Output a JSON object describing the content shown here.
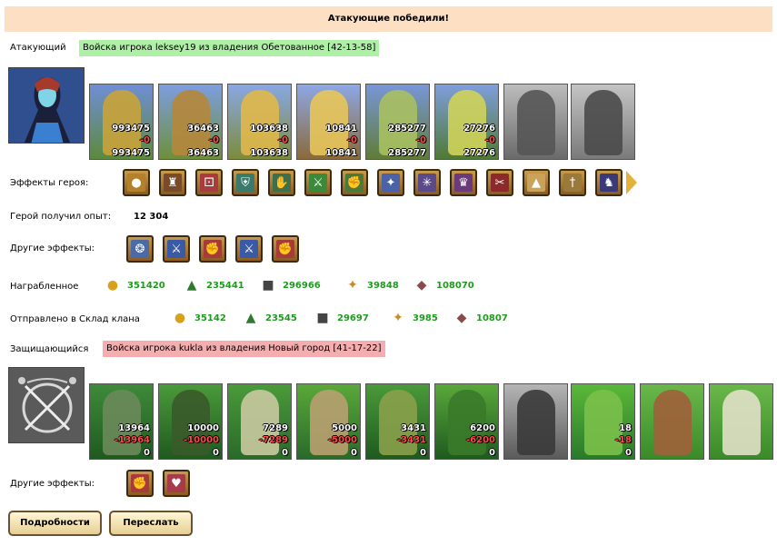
{
  "banner": "Атакующие победили!",
  "attacker": {
    "label": "Атакующий",
    "army": "Войска игрока leksey19 из владения Обетованное [42-13-58]",
    "units": [
      {
        "count": "993475",
        "loss": "-0",
        "remain": "993475"
      },
      {
        "count": "36463",
        "loss": "-0",
        "remain": "36463"
      },
      {
        "count": "103638",
        "loss": "-0",
        "remain": "103638"
      },
      {
        "count": "10841",
        "loss": "-0",
        "remain": "10841"
      },
      {
        "count": "285277",
        "loss": "-0",
        "remain": "285277"
      },
      {
        "count": "27276",
        "loss": "-0",
        "remain": "27276"
      }
    ]
  },
  "hero_effects_label": "Эффекты героя:",
  "experience": {
    "label": "Герой получил опыт:",
    "value": "12 304"
  },
  "other_effects_label": "Другие эффекты:",
  "loot": {
    "label": "Награбленное",
    "items": [
      {
        "icon": "gold-icon",
        "value": "351420"
      },
      {
        "icon": "wood-icon",
        "value": "235441"
      },
      {
        "icon": "ore-icon",
        "value": "296966"
      },
      {
        "icon": "wheat-icon",
        "value": "39848"
      },
      {
        "icon": "clay-icon",
        "value": "108070"
      }
    ]
  },
  "clan_storage": {
    "label": "Отправлено в Склад клана",
    "items": [
      {
        "icon": "gold-icon",
        "value": "35142"
      },
      {
        "icon": "wood-icon",
        "value": "23545"
      },
      {
        "icon": "ore-icon",
        "value": "29697"
      },
      {
        "icon": "wheat-icon",
        "value": "3985"
      },
      {
        "icon": "clay-icon",
        "value": "10807"
      }
    ]
  },
  "defender": {
    "label": "Защищающийся",
    "army": "Войска игрока kukla из владения Новый город [41-17-22]",
    "units": [
      {
        "count": "13964",
        "loss": "-13964",
        "remain": "0"
      },
      {
        "count": "10000",
        "loss": "-10000",
        "remain": "0"
      },
      {
        "count": "7289",
        "loss": "-7289",
        "remain": "0"
      },
      {
        "count": "5000",
        "loss": "-5000",
        "remain": "0"
      },
      {
        "count": "3431",
        "loss": "-3431",
        "remain": "0"
      },
      {
        "count": "6200",
        "loss": "-6200",
        "remain": "0"
      },
      {
        "count": "",
        "loss": "",
        "remain": ""
      },
      {
        "count": "18",
        "loss": "-18",
        "remain": "0"
      },
      {
        "count": "",
        "loss": "",
        "remain": ""
      },
      {
        "count": "",
        "loss": "",
        "remain": ""
      }
    ]
  },
  "defender_other_effects_label": "Другие эффекты:",
  "buttons": {
    "details": "Подробности",
    "forward": "Переслать"
  }
}
